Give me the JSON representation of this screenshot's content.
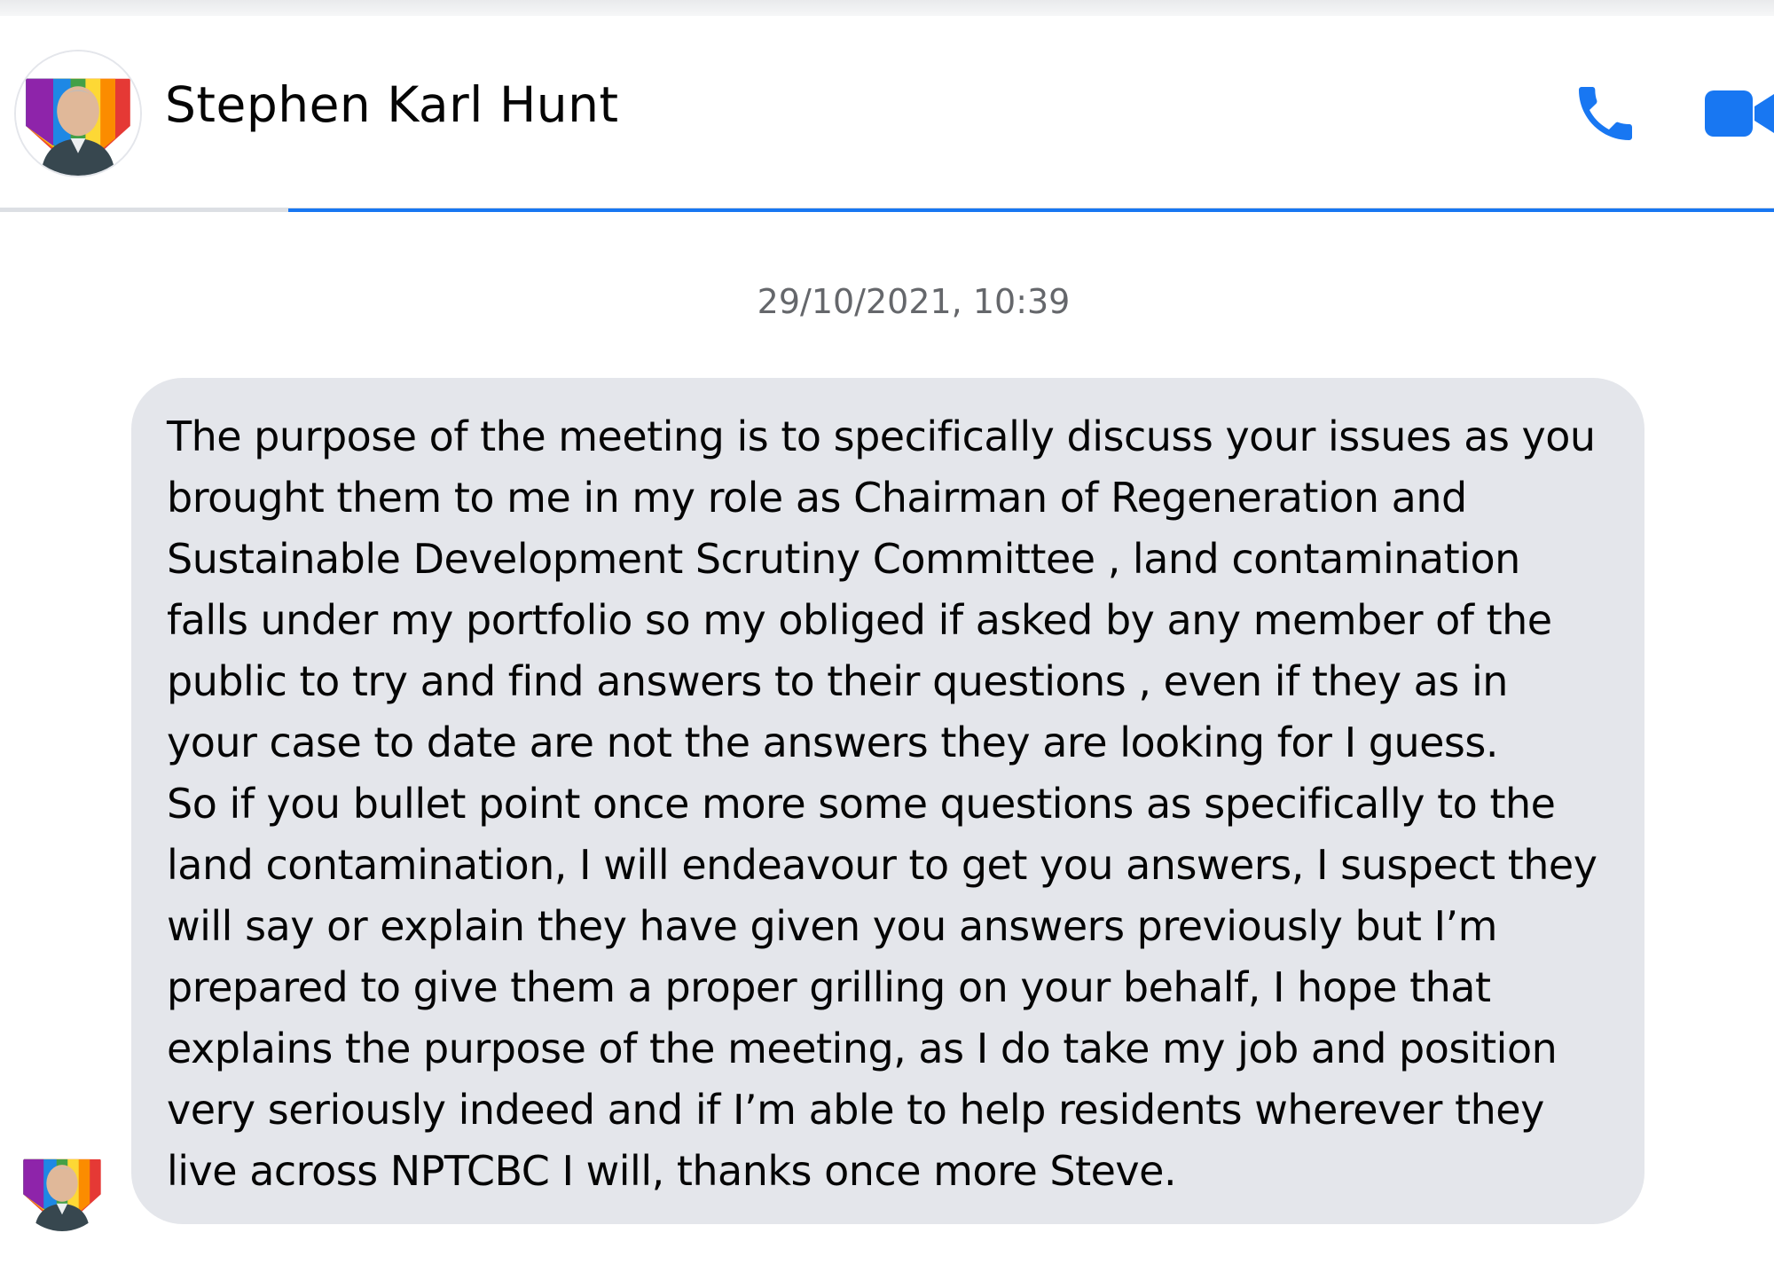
{
  "conversation": {
    "contact_name": "Stephen Karl Hunt",
    "actions": [
      {
        "icon": "phone-icon"
      },
      {
        "icon": "video-camera-icon"
      }
    ],
    "accent_color": "#1877f2"
  },
  "thread": {
    "timestamp": "29/10/2021, 10:39",
    "messages": [
      {
        "sender": "Stephen Karl Hunt",
        "bubble_color": "#e4e6eb",
        "text": "The purpose of the meeting is to specifically discuss your issues as you brought them to me in my role as Chairman of Regeneration and Sustainable Development Scrutiny Committee , land contamination falls under my portfolio so my obliged if asked by any member of the public to try and find answers to their questions , even if they as in your case to date are not the answers they are looking for I guess.\nSo if you bullet point once more some questions as specifically to the land contamination, I will endeavour to get you answers, I suspect they will say or explain they have given you answers previously but I’m prepared to give them a proper grilling on your behalf, I hope that explains the purpose of the meeting, as I do take my job and position very seriously indeed and if I’m able to help residents wherever they live across NPTCBC I will, thanks once more Steve."
      }
    ]
  }
}
